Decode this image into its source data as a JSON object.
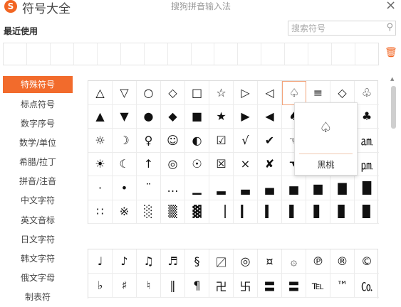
{
  "app": {
    "logo_glyph": "S",
    "title": "符号大全",
    "window_title": "搜狗拼音输入法",
    "close_glyph": "×",
    "brand_color": "#f26522"
  },
  "recent": {
    "label": "最近使用"
  },
  "search": {
    "placeholder": "搜索符号",
    "icon": "magnifier-icon"
  },
  "trash": {
    "glyph": "🗑",
    "icon": "trash-icon"
  },
  "sidebar": {
    "items": [
      {
        "label": "特殊符号",
        "active": true
      },
      {
        "label": "标点符号"
      },
      {
        "label": "数字序号"
      },
      {
        "label": "数学/单位"
      },
      {
        "label": "希腊/拉丁"
      },
      {
        "label": "拼音/注音"
      },
      {
        "label": "中文字符"
      },
      {
        "label": "英文音标"
      },
      {
        "label": "日文字符"
      },
      {
        "label": "韩文字符"
      },
      {
        "label": "俄文字母"
      },
      {
        "label": "制表符"
      }
    ]
  },
  "symbols_grid1": [
    "△",
    "▽",
    "○",
    "◇",
    "□",
    "☆",
    "▷",
    "◁",
    "♤",
    "≡",
    "◇",
    "♧",
    "▲",
    "▼",
    "●",
    "◆",
    "■",
    "★",
    "▶",
    "◀",
    "♠",
    "",
    "",
    "♣",
    "☼",
    "☽",
    "♀",
    "☺",
    "◐",
    "☑",
    "√",
    "✔",
    "☜",
    "",
    "",
    "㏂",
    "☀",
    "☾",
    "↑",
    "◎",
    "☉",
    "☒",
    "×",
    "✘",
    "☚",
    "",
    "",
    "㏘",
    "·",
    "•",
    "¨",
    "…",
    "▁",
    "▂",
    "▃",
    "▄",
    "▅",
    "▆",
    "▇",
    "█",
    "∷",
    "※",
    "░",
    "▒",
    "▓",
    "▕",
    "▎",
    "▍",
    "▌",
    "▋",
    "▊",
    "▉"
  ],
  "symbols_grid2": [
    "♩",
    "♪",
    "♫",
    "♬",
    "§",
    "〼",
    "◎",
    "¤",
    "۞",
    "℗",
    "®",
    "©",
    "♭",
    "♯",
    "♮",
    "‖",
    "¶",
    "卍",
    "卐",
    "〓",
    "〓",
    "℡",
    "™",
    "㏇"
  ],
  "popup": {
    "glyph": "♤",
    "name": "黑桃"
  },
  "scroll": {
    "up_glyph": "▲"
  }
}
